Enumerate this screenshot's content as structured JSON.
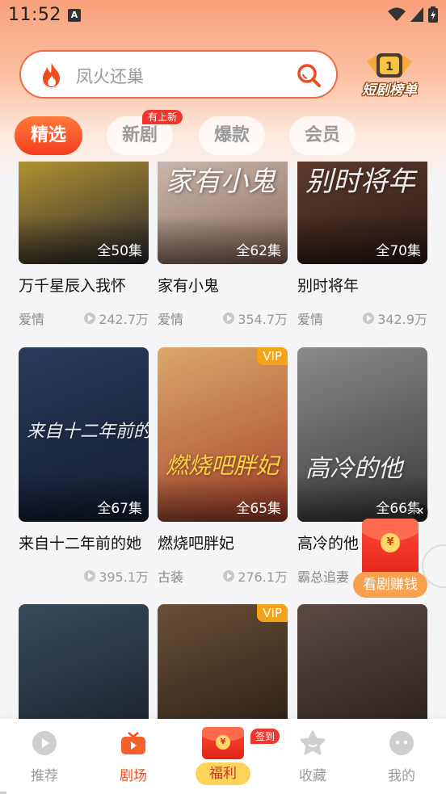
{
  "status_bar": {
    "time": "11:52",
    "notification_letter": "A"
  },
  "search": {
    "placeholder": "凤火还巢"
  },
  "rank_badge": {
    "label": "短剧榜单"
  },
  "tabs": [
    {
      "label": "精选",
      "active": true,
      "badge": ""
    },
    {
      "label": "新剧",
      "active": false,
      "badge": "有上新"
    },
    {
      "label": "爆款",
      "active": false,
      "badge": ""
    },
    {
      "label": "会员",
      "active": false,
      "badge": ""
    }
  ],
  "dramas": [
    {
      "title": "万千星辰入我怀",
      "episodes": "全50集",
      "genre": "爱情",
      "views": "242.7万",
      "vip": false,
      "art": "",
      "colors": [
        "#f2c230",
        "#2a2a30"
      ]
    },
    {
      "title": "家有小鬼",
      "episodes": "全62集",
      "genre": "爱情",
      "views": "354.7万",
      "vip": false,
      "art": "家有小鬼",
      "colors": [
        "#e8dcd4",
        "#8a6a5c"
      ]
    },
    {
      "title": "别时将年",
      "episodes": "全70集",
      "genre": "爱情",
      "views": "342.9万",
      "vip": false,
      "art": "别时将年",
      "colors": [
        "#7a4a38",
        "#2a1a16"
      ]
    },
    {
      "title": "来自十二年前的她",
      "episodes": "全67集",
      "genre": "",
      "views": "395.1万",
      "vip": false,
      "art": "来自十二年前的她",
      "colors": [
        "#2a3a5c",
        "#141c30"
      ]
    },
    {
      "title": "燃烧吧胖妃",
      "episodes": "全65集",
      "genre": "古装",
      "views": "276.1万",
      "vip": true,
      "vip_label": "VIP",
      "art": "燃烧吧胖妃",
      "colors": [
        "#d9a86a",
        "#a8402a"
      ]
    },
    {
      "title": "高冷的他",
      "episodes": "全66集",
      "genre": "霸总追妻",
      "views": "",
      "vip": false,
      "art": "高冷的他",
      "colors": [
        "#8a8a8a",
        "#3a3a3a"
      ]
    },
    {
      "title": "",
      "episodes": "",
      "genre": "",
      "views": "",
      "vip": false,
      "art": "",
      "colors": [
        "#3a4a5a",
        "#141a22"
      ]
    },
    {
      "title": "",
      "episodes": "",
      "genre": "",
      "views": "",
      "vip": true,
      "vip_label": "VIP",
      "art": "",
      "colors": [
        "#6a5036",
        "#1a140e"
      ]
    },
    {
      "title": "",
      "episodes": "",
      "genre": "",
      "views": "",
      "vip": false,
      "art": "",
      "colors": [
        "#5a4a44",
        "#1e1614"
      ]
    }
  ],
  "float_redpack": {
    "label": "看剧赚钱",
    "coin": "¥"
  },
  "bottom_nav": {
    "recommend": "推荐",
    "theater": "剧场",
    "welfare": "福利",
    "checkin_badge": "签到",
    "favorites": "收藏",
    "mine": "我的",
    "coin": "¥"
  },
  "colors": {
    "accent": "#f04a1e",
    "vip": "#f4a21a",
    "badge": "#f2362b"
  }
}
